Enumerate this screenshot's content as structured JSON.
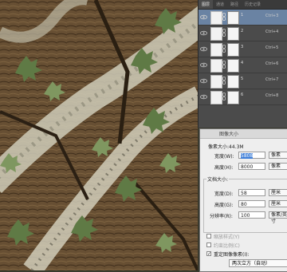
{
  "layers_panel": {
    "tabs": [
      "图层",
      "通道",
      "路径",
      "历史记录"
    ],
    "active_tab": 0,
    "layers": [
      {
        "name": "1",
        "shortcut": "Ctrl+3",
        "selected": true
      },
      {
        "name": "2",
        "shortcut": "Ctrl+4",
        "selected": false
      },
      {
        "name": "3",
        "shortcut": "Ctrl+5",
        "selected": false
      },
      {
        "name": "4",
        "shortcut": "Ctrl+6",
        "selected": false
      },
      {
        "name": "5",
        "shortcut": "Ctrl+7",
        "selected": false
      },
      {
        "name": "6",
        "shortcut": "Ctrl+8",
        "selected": false
      }
    ]
  },
  "image_size_dialog": {
    "title": "图像大小",
    "pixel_size_label": "像素大小:44.3M",
    "width_label": "宽度(W):",
    "width_value": "5808",
    "width_unit": "像素",
    "height_label": "高度(H):",
    "height_value": "8000",
    "height_unit": "像素",
    "doc_size_label": "文档大小:",
    "doc_width_label": "宽度(D):",
    "doc_width_value": "58",
    "doc_width_unit": "厘米",
    "doc_height_label": "高度(G):",
    "doc_height_value": "80",
    "doc_height_unit": "厘米",
    "resolution_label": "分辨率(R):",
    "resolution_value": "100",
    "resolution_unit": "像素/英寸",
    "scale_styles_label": "缩放样式(Y)",
    "constrain_label": "约束比例(C)",
    "resample_label": "重定图像像素(I):",
    "resample_method": "两次立方（自动）"
  },
  "colors": {
    "selected_layer": "#6a83a3",
    "highlight": "#3f7fd8"
  }
}
